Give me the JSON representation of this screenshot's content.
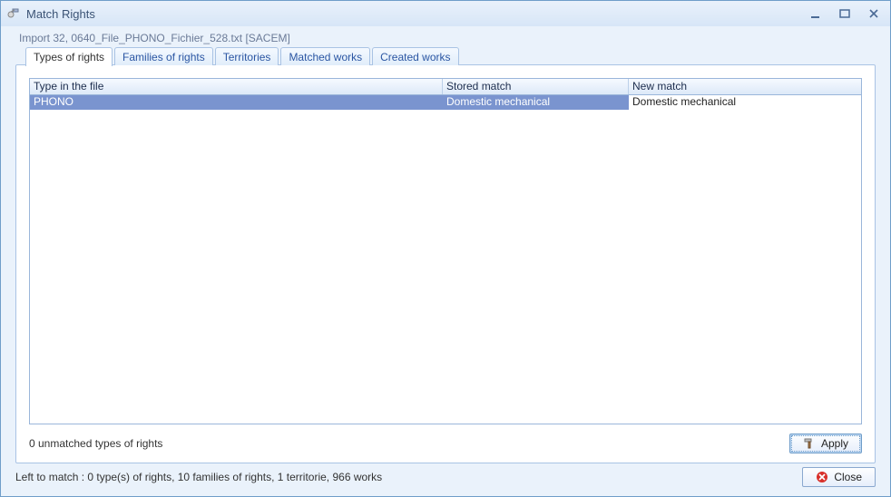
{
  "window": {
    "title": "Match Rights"
  },
  "subtitle": "Import 32, 0640_File_PHONO_Fichier_528.txt [SACEM]",
  "tabs": [
    {
      "label": "Types of rights",
      "active": true
    },
    {
      "label": "Families of rights",
      "active": false
    },
    {
      "label": "Territories",
      "active": false
    },
    {
      "label": "Matched works",
      "active": false
    },
    {
      "label": "Created works",
      "active": false
    }
  ],
  "table": {
    "columns": {
      "c1": "Type in the file",
      "c2": "Stored match",
      "c3": "New match"
    },
    "rows": [
      {
        "type_in_file": "PHONO",
        "stored_match": "Domestic mechanical",
        "new_match": "Domestic mechanical",
        "selected": true
      }
    ]
  },
  "panel_footer": {
    "unmatched": "0 unmatched types of rights",
    "apply_label": "Apply"
  },
  "bottom": {
    "status": "Left to match : 0 type(s) of rights, 10 families of rights, 1 territorie, 966 works",
    "close_label": "Close"
  },
  "colors": {
    "selection": "#7a94cf",
    "border": "#a9c3e4"
  }
}
